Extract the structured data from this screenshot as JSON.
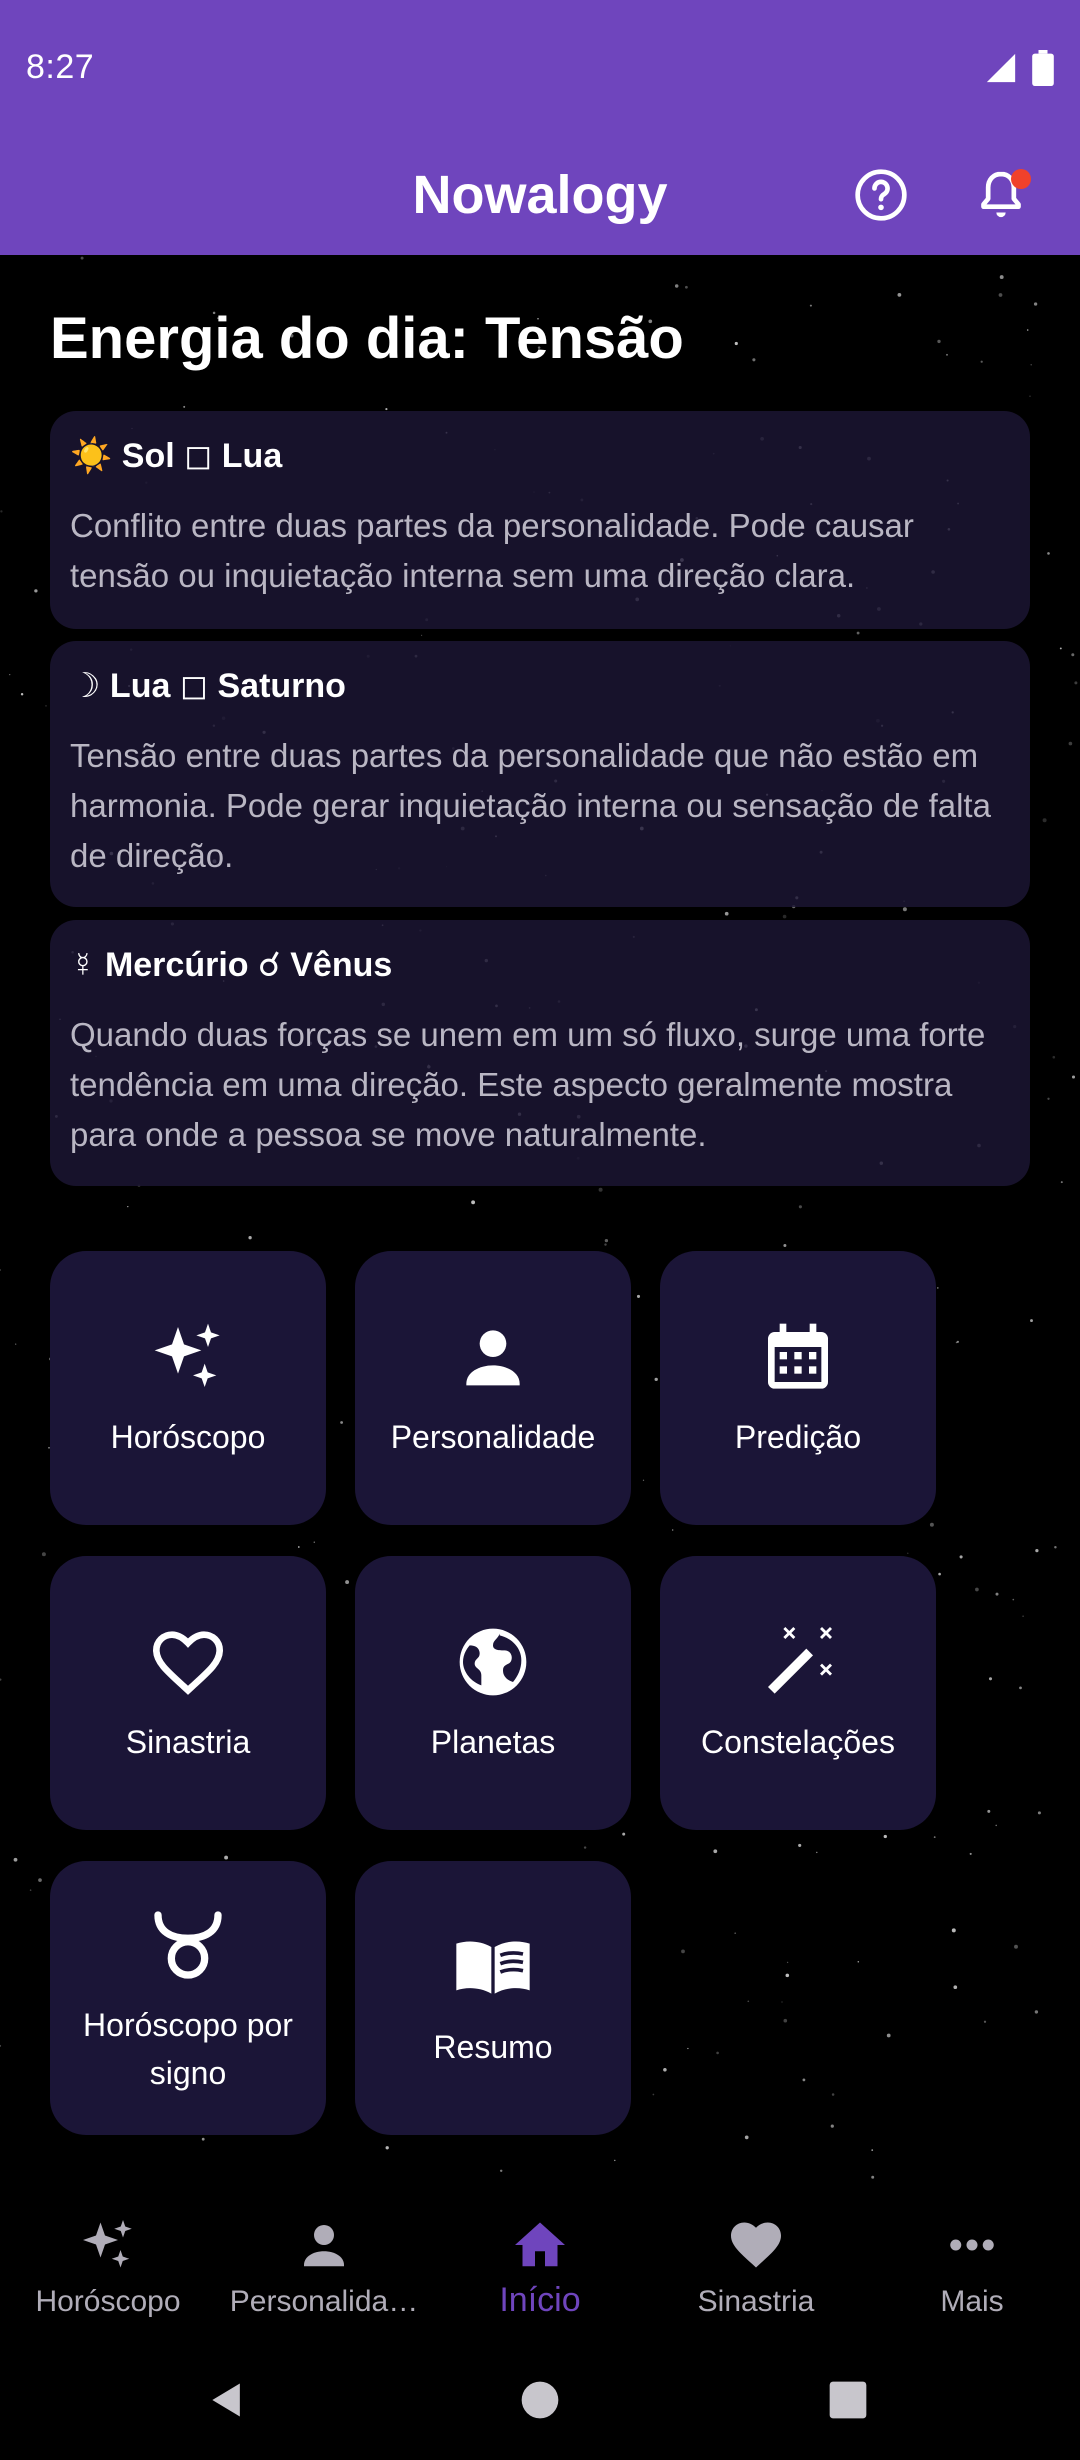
{
  "status_bar": {
    "time": "8:27"
  },
  "app_bar": {
    "title": "Nowalogy"
  },
  "energy": {
    "title": "Energia do dia: Tensão",
    "aspects": [
      {
        "title": "☀️ Sol ◻ Lua",
        "text": "Conflito entre duas partes da personalidade. Pode causar tensão ou inquietação interna sem uma direção clara."
      },
      {
        "title": "☽ Lua ◻ Saturno",
        "text": "Tensão entre duas partes da personalidade que não estão em harmonia. Pode gerar inquietação interna ou sensação de falta de direção."
      },
      {
        "title": "☿ Mercúrio ☌ Vênus",
        "text": "Quando duas forças se unem em um só fluxo, surge uma forte tendência em uma direção. Este aspecto geralmente mostra para onde a pessoa se move naturalmente."
      }
    ]
  },
  "tiles": [
    {
      "label": "Horóscopo",
      "icon": "sparkles-icon"
    },
    {
      "label": "Personalidade",
      "icon": "person-icon"
    },
    {
      "label": "Predição",
      "icon": "calendar-icon"
    },
    {
      "label": "Sinastria",
      "icon": "heart-outline-icon"
    },
    {
      "label": "Planetas",
      "icon": "globe-icon"
    },
    {
      "label": "Constelações",
      "icon": "magic-wand-icon"
    },
    {
      "label": "Horóscopo por signo",
      "icon": "taurus-icon"
    },
    {
      "label": "Resumo",
      "icon": "book-icon"
    }
  ],
  "bottom_nav": [
    {
      "label": "Horóscopo",
      "icon": "sparkles-icon",
      "active": false
    },
    {
      "label": "Personalida…",
      "icon": "person-icon",
      "active": false
    },
    {
      "label": "Início",
      "icon": "home-icon",
      "active": true
    },
    {
      "label": "Sinastria",
      "icon": "heart-icon",
      "active": false
    },
    {
      "label": "Mais",
      "icon": "more-horizontal-icon",
      "active": false
    }
  ],
  "colors": {
    "app_bar": "#6f45bd",
    "accent": "#6f45bd",
    "card": "#1b1537",
    "notification_dot": "#f0412b"
  }
}
